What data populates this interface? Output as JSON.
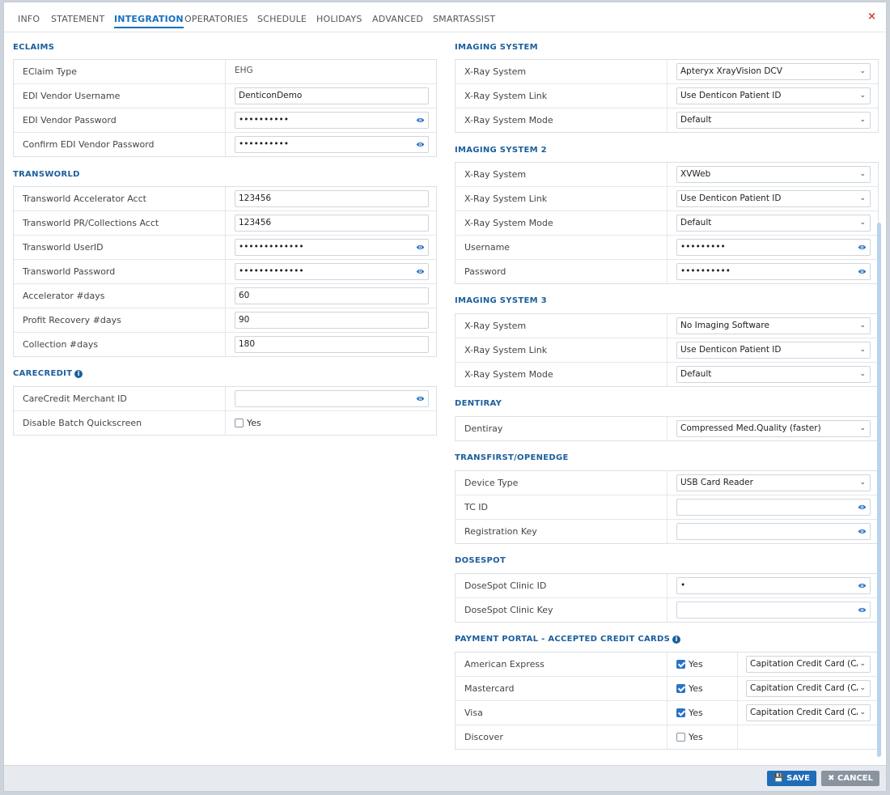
{
  "tabs": [
    "INFO",
    "STATEMENT",
    "INTEGRATION",
    "OPERATORIES",
    "SCHEDULE",
    "HOLIDAYS",
    "ADVANCED",
    "SMARTASSIST"
  ],
  "active_tab": "INTEGRATION",
  "close_label": "×",
  "left": {
    "eclaims": {
      "title": "ECLAIMS",
      "rows": [
        {
          "label": "EClaim Type",
          "value": "EHG"
        },
        {
          "label": "EDI Vendor Username",
          "value": "DenticonDemo"
        },
        {
          "label": "EDI Vendor Password",
          "value": "••••••••••"
        },
        {
          "label": "Confirm EDI Vendor Password",
          "value": "••••••••••"
        }
      ]
    },
    "transworld": {
      "title": "TRANSWORLD",
      "rows": [
        {
          "label": "Transworld Accelerator Acct",
          "value": "123456"
        },
        {
          "label": "Transworld PR/Collections Acct",
          "value": "123456"
        },
        {
          "label": "Transworld UserID",
          "value": "•••••••••••••"
        },
        {
          "label": "Transworld Password",
          "value": "•••••••••••••"
        },
        {
          "label": "Accelerator #days",
          "value": "60"
        },
        {
          "label": "Profit Recovery #days",
          "value": "90"
        },
        {
          "label": "Collection #days",
          "value": "180"
        }
      ]
    },
    "carecredit": {
      "title": "CARECREDIT",
      "rows": [
        {
          "label": "CareCredit Merchant ID",
          "value": ""
        },
        {
          "label": "Disable Batch Quickscreen",
          "value": "Yes"
        }
      ]
    }
  },
  "right": {
    "imaging1": {
      "title": "IMAGING SYSTEM",
      "rows": [
        {
          "label": "X-Ray System",
          "value": "Apteryx XrayVision DCV"
        },
        {
          "label": "X-Ray System Link",
          "value": "Use Denticon Patient ID"
        },
        {
          "label": "X-Ray System Mode",
          "value": "Default"
        }
      ]
    },
    "imaging2": {
      "title": "IMAGING SYSTEM 2",
      "rows": [
        {
          "label": "X-Ray System",
          "value": "XVWeb"
        },
        {
          "label": "X-Ray System Link",
          "value": "Use Denticon Patient ID"
        },
        {
          "label": "X-Ray System Mode",
          "value": "Default"
        },
        {
          "label": "Username",
          "value": "•••••••••"
        },
        {
          "label": "Password",
          "value": "••••••••••"
        }
      ]
    },
    "imaging3": {
      "title": "IMAGING SYSTEM 3",
      "rows": [
        {
          "label": "X-Ray System",
          "value": "No Imaging Software"
        },
        {
          "label": "X-Ray System Link",
          "value": "Use Denticon Patient ID"
        },
        {
          "label": "X-Ray System Mode",
          "value": "Default"
        }
      ]
    },
    "dentiray": {
      "title": "DENTIRAY",
      "rows": [
        {
          "label": "Dentiray",
          "value": "Compressed Med.Quality (faster)"
        }
      ]
    },
    "transfirst": {
      "title": "TRANSFIRST/OPENEDGE",
      "rows": [
        {
          "label": "Device Type",
          "value": "USB Card Reader"
        },
        {
          "label": "TC ID",
          "value": ""
        },
        {
          "label": "Registration Key",
          "value": ""
        }
      ]
    },
    "dosespot": {
      "title": "DOSESPOT",
      "rows": [
        {
          "label": "DoseSpot Clinic ID",
          "value": "•"
        },
        {
          "label": "DoseSpot Clinic Key",
          "value": ""
        }
      ]
    },
    "payment": {
      "title": "PAYMENT PORTAL - ACCEPTED CREDIT CARDS",
      "yes_label": "Yes",
      "rows": [
        {
          "label": "American Express",
          "checked": true,
          "select": "Capitation Credit Card (CA"
        },
        {
          "label": "Mastercard",
          "checked": true,
          "select": "Capitation Credit Card (CA"
        },
        {
          "label": "Visa",
          "checked": true,
          "select": "Capitation Credit Card (CA"
        },
        {
          "label": "Discover",
          "checked": false,
          "select": ""
        }
      ]
    }
  },
  "footer": {
    "save_label": "SAVE",
    "cancel_label": "CANCEL"
  },
  "colors": {
    "accent": "#1670c0",
    "section_title": "#1a5e9c",
    "save": "#1f6db8",
    "cancel": "#8a949e",
    "close": "#d23a3a"
  }
}
